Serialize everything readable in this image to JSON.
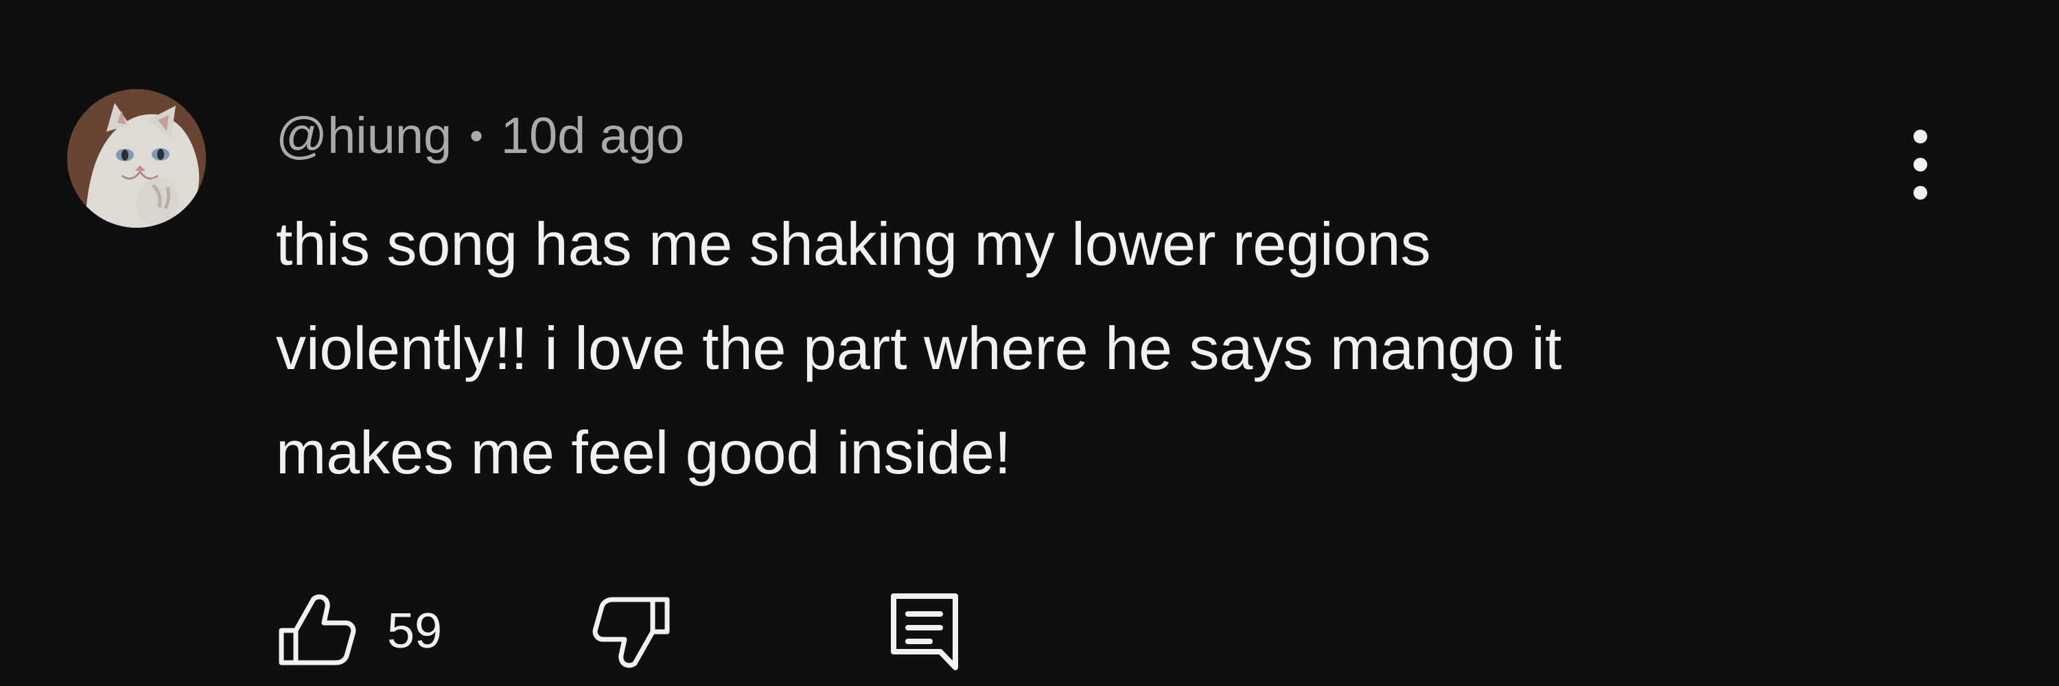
{
  "comment": {
    "author": "@hiung",
    "separator": "•",
    "timestamp": "10d ago",
    "text_lines": [
      "this song has me shaking my lower regions",
      "violently!! i love the part where he says mango it",
      "makes me feel good inside!"
    ],
    "like_count": "59"
  },
  "icons": {
    "avatar": "cat-avatar",
    "more": "more-vertical-icon",
    "like": "thumbs-up-icon",
    "dislike": "thumbs-down-icon",
    "reply": "reply-comment-icon"
  },
  "colors": {
    "background": "#0f0f0f",
    "primary_text": "#f1f1f1",
    "secondary_text": "#aaaaaa"
  }
}
